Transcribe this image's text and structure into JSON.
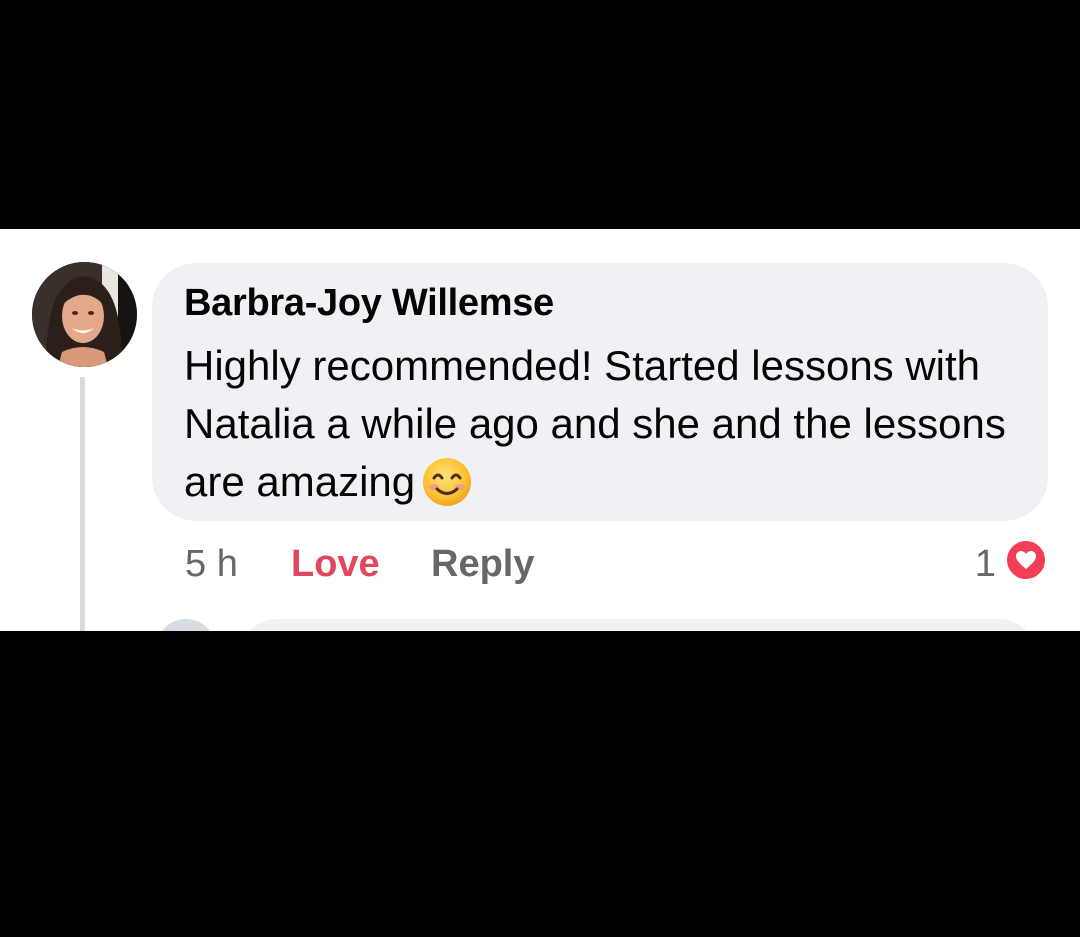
{
  "comment": {
    "author": "Barbra-Joy Willemse",
    "text": "Highly recommended! Started lessons with Natalia a while ago and she and the lessons are amazing",
    "emoji": "smiling-face-with-smiling-eyes",
    "avatar_icon": "profile-photo"
  },
  "actions": {
    "time": "5 h",
    "love_label": "Love",
    "reply_label": "Reply"
  },
  "reactions": {
    "count": "1",
    "icon": "heart-icon"
  },
  "colors": {
    "love": "#e0485f",
    "heart_badge": "#f33e58",
    "bubble": "#f0f1f4",
    "secondary_text": "#65676b"
  }
}
